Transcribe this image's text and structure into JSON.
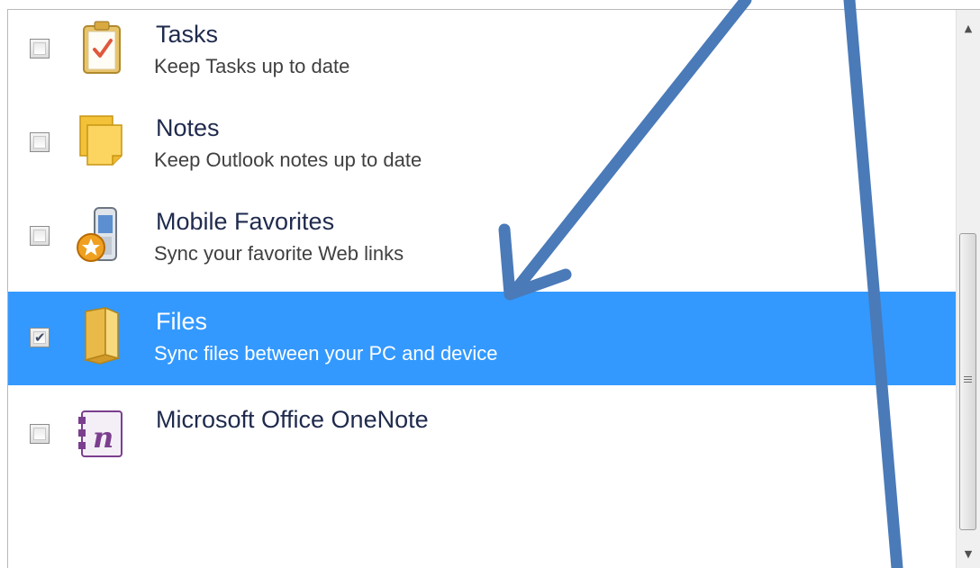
{
  "items": [
    {
      "title": "Tasks",
      "subtitle": "Keep Tasks up to date",
      "checked": false,
      "selected": false,
      "icon": "tasks-clipboard-icon"
    },
    {
      "title": "Notes",
      "subtitle": "Keep Outlook notes up to date",
      "checked": false,
      "selected": false,
      "icon": "notes-icon"
    },
    {
      "title": "Mobile Favorites",
      "subtitle": "Sync your favorite Web links",
      "checked": false,
      "selected": false,
      "icon": "mobile-favorites-icon"
    },
    {
      "title": "Files",
      "subtitle": "Sync files between your PC and device",
      "checked": true,
      "selected": true,
      "icon": "files-folder-icon"
    },
    {
      "title": "Microsoft Office OneNote",
      "subtitle": "",
      "checked": false,
      "selected": false,
      "icon": "onenote-icon"
    }
  ],
  "colors": {
    "selection": "#3399ff",
    "annotation_arrow": "#4a7ab8",
    "title_text": "#1f2a4d"
  }
}
